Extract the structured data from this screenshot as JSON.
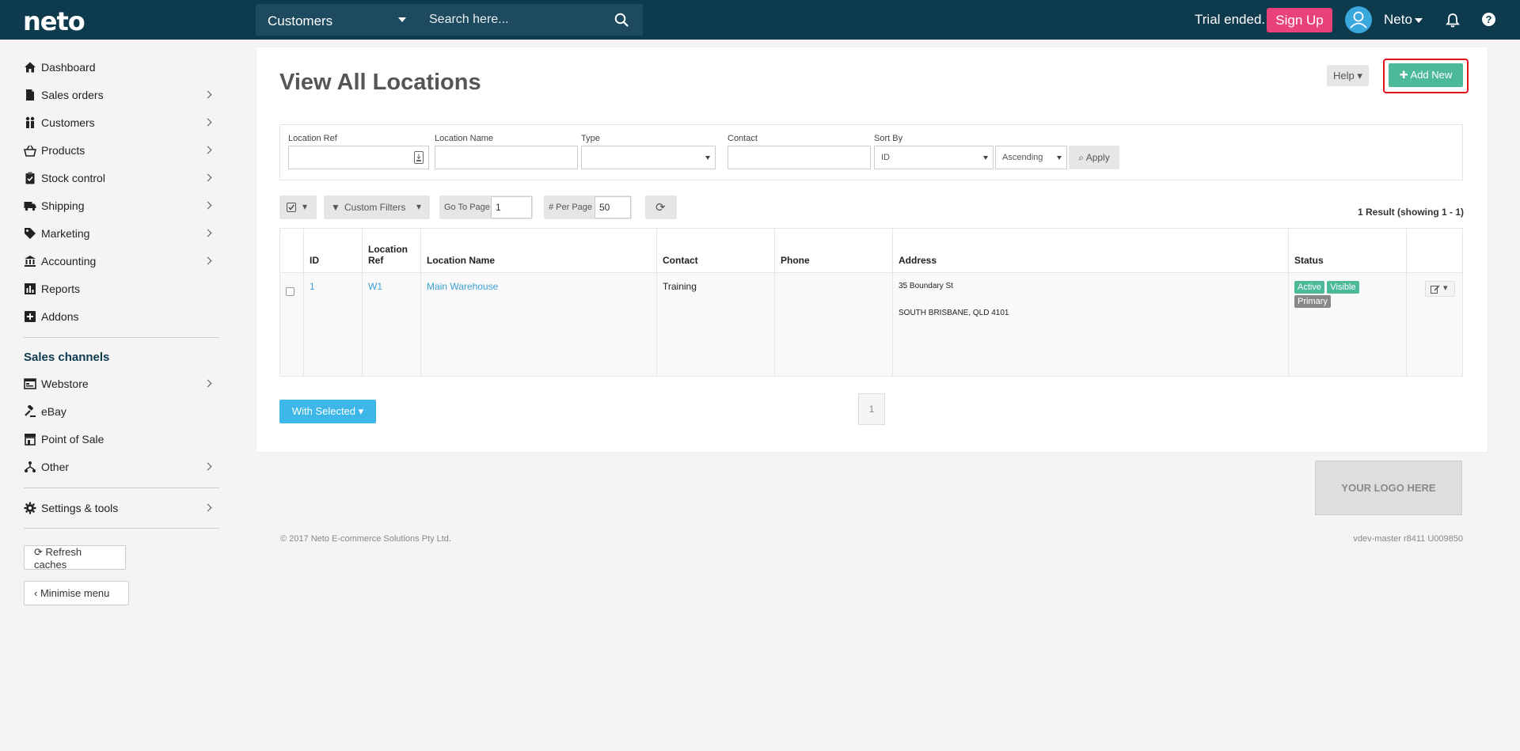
{
  "topbar": {
    "logo": "neto",
    "search_scope": "Customers",
    "search_placeholder": "Search here...",
    "trial_text": "Trial ended.",
    "signup_label": "Sign Up",
    "user_name": "Neto",
    "help_glyph": "?"
  },
  "sidebar": {
    "items": [
      {
        "label": "Dashboard",
        "icon": "home-icon"
      },
      {
        "label": "Sales orders",
        "icon": "document-icon"
      },
      {
        "label": "Customers",
        "icon": "users-icon"
      },
      {
        "label": "Products",
        "icon": "basket-icon"
      },
      {
        "label": "Stock control",
        "icon": "clipboard-icon"
      },
      {
        "label": "Shipping",
        "icon": "truck-icon"
      },
      {
        "label": "Marketing",
        "icon": "tag-icon"
      },
      {
        "label": "Accounting",
        "icon": "bank-icon"
      },
      {
        "label": "Reports",
        "icon": "chart-icon"
      },
      {
        "label": "Addons",
        "icon": "plus-square-icon"
      }
    ],
    "channels_heading": "Sales channels",
    "channels": [
      {
        "label": "Webstore",
        "icon": "webstore-icon"
      },
      {
        "label": "eBay",
        "icon": "gavel-icon"
      },
      {
        "label": "Point of Sale",
        "icon": "store-icon"
      },
      {
        "label": "Other",
        "icon": "network-icon"
      }
    ],
    "settings_label": "Settings & tools",
    "refresh_label": "Refresh caches",
    "minimise_label": "Minimise menu"
  },
  "page": {
    "title": "View All Locations",
    "help_label": "Help",
    "add_label": "Add New"
  },
  "filters": {
    "location_ref_label": "Location Ref",
    "location_name_label": "Location Name",
    "type_label": "Type",
    "contact_label": "Contact",
    "sort_by_label": "Sort By",
    "sort_by_value": "ID",
    "order_value": "Ascending",
    "apply_label": "Apply"
  },
  "toolbar": {
    "custom_filters_label": "Custom Filters",
    "go_to_page_label": "Go To Page",
    "go_to_page_value": "1",
    "per_page_label": "# Per Page",
    "per_page_value": "50",
    "results_text": "1 Result (showing 1 - 1)"
  },
  "table": {
    "headers": {
      "id": "ID",
      "ref_line1": "Location",
      "ref_line2": "Ref",
      "name": "Location Name",
      "contact": "Contact",
      "phone": "Phone",
      "address": "Address",
      "status": "Status"
    },
    "rows": [
      {
        "id": "1",
        "ref": "W1",
        "name": "Main Warehouse",
        "contact": "Training",
        "phone": "",
        "address_line1": "35 Boundary St",
        "address_line2": "SOUTH BRISBANE, QLD 4101",
        "status_badges": [
          "Active",
          "Visible",
          "Primary"
        ]
      }
    ]
  },
  "bottom": {
    "with_selected_label": "With  Selected",
    "current_page": "1"
  },
  "branding": {
    "logo_placeholder": "YOUR LOGO HERE"
  },
  "footer": {
    "copyright": "© 2017 Neto E-commerce Solutions Pty Ltd.",
    "version": "vdev-master r8411 U009850"
  },
  "colors": {
    "topbar": "#0e3a4e",
    "accent_green": "#4cb998",
    "signup_pink": "#e9417a",
    "link_blue": "#3c9fd6",
    "highlight_red": "#e0141d"
  }
}
